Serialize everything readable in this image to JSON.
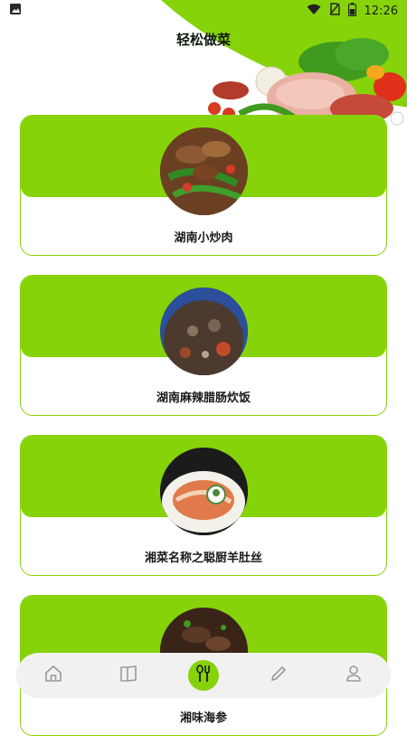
{
  "status_bar": {
    "time": "12:26",
    "icons": [
      "gallery-icon",
      "wifi-icon",
      "no-sim-icon",
      "battery-icon"
    ]
  },
  "header": {
    "title": "轻松做菜"
  },
  "colors": {
    "accent": "#86d30a",
    "text": "#1a1a1a",
    "nav_bg": "#f1f1f1"
  },
  "recipes": [
    {
      "title": "湖南小炒肉"
    },
    {
      "title": "湖南麻辣腊肠炊饭"
    },
    {
      "title": "湘菜名称之聪厨羊肚丝"
    },
    {
      "title": "湘味海参"
    }
  ],
  "bottom_nav": {
    "items": [
      {
        "icon": "home-icon",
        "active": false
      },
      {
        "icon": "book-icon",
        "active": false
      },
      {
        "icon": "fork-spoon-icon",
        "active": true
      },
      {
        "icon": "pencil-icon",
        "active": false
      },
      {
        "icon": "user-icon",
        "active": false
      }
    ]
  }
}
